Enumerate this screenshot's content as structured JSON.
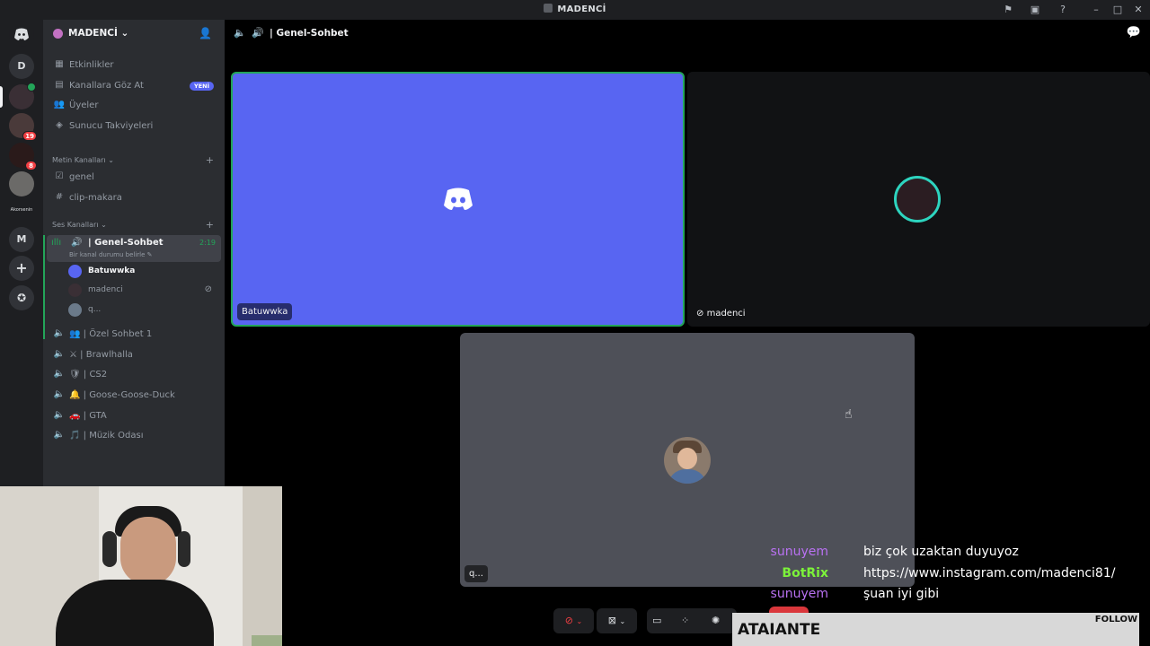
{
  "window": {
    "title": "MADENCİ"
  },
  "rail": {
    "home_icon": "discord-logo-icon",
    "items": [
      {
        "label": "D"
      },
      {
        "label": "",
        "badge": ""
      },
      {
        "label": "",
        "badge": "19"
      },
      {
        "label": "",
        "badge": "8"
      },
      {
        "label": ""
      },
      {
        "label": "Akorsenin"
      },
      {
        "label": "M"
      }
    ],
    "add_icon": "plus-icon",
    "explore_icon": "compass-icon"
  },
  "server": {
    "name": "MADENCİ",
    "top_items": [
      {
        "label": "Etkinlikler",
        "icon": "calendar-icon"
      },
      {
        "label": "Kanallara Göz At",
        "icon": "browse-icon",
        "badge": "YENİ"
      },
      {
        "label": "Üyeler",
        "icon": "members-icon"
      },
      {
        "label": "Sunucu Takviyeleri",
        "icon": "boost-icon"
      }
    ],
    "text_category": "Metin Kanalları",
    "text_channels": [
      {
        "label": "genel",
        "icon": "rules-icon"
      },
      {
        "label": "clip-makara",
        "icon": "hash-icon"
      }
    ],
    "voice_category": "Ses Kanalları",
    "active_voice": {
      "name": "Genel-Sohbet",
      "timer": "2:19",
      "status": "Bir kanal durumu belirle",
      "users": [
        {
          "name": "Batuwwka"
        },
        {
          "name": "madenci"
        },
        {
          "name": "q..."
        }
      ]
    },
    "voice_channels": [
      {
        "label": "Özel Sohbet 1",
        "emoji": "👥"
      },
      {
        "label": "Brawlhalla",
        "emoji": "⚔"
      },
      {
        "label": "CS2",
        "emoji": "🛡"
      },
      {
        "label": "Goose-Goose-Duck",
        "emoji": "🔔"
      },
      {
        "label": "GTA",
        "emoji": "🚗"
      },
      {
        "label": "Müzik Odası",
        "emoji": "🎵"
      }
    ]
  },
  "main": {
    "channel_title": "Genel-Sohbet",
    "tiles": [
      {
        "label": "Batuwwka",
        "bg": "#5865f2"
      },
      {
        "label": "madenci",
        "bg": "#111214"
      },
      {
        "label": "q...",
        "bg": "#4e5058"
      }
    ]
  },
  "chat": [
    {
      "user": "sunuyem",
      "color": "#b971f2",
      "msg": "biz çok uzaktan duyuyoz"
    },
    {
      "user": "BotRix",
      "color": "#7cf23a",
      "msg": "https://www.instagram.com/madenci81/"
    },
    {
      "user": "sunuyem",
      "color": "#b971f2",
      "msg": "şuan iyi gibi"
    }
  ],
  "follow": {
    "name": "ATAIANTE",
    "label": "FOLLOW"
  }
}
